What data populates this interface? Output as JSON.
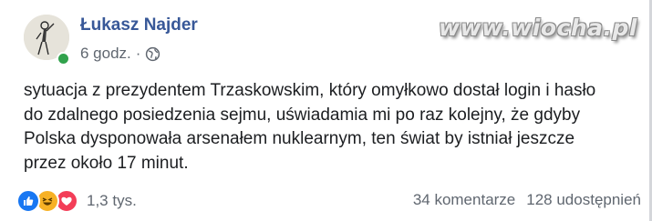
{
  "post": {
    "author": "Łukasz Najder",
    "time": "6 godz.",
    "separator": "·",
    "audience_icon": "globe-icon",
    "lines": [
      "sytuacja z prezydentem Trzaskowskim, który omyłkowo dostał login i hasło",
      "do zdalnego posiedzenia sejmu, uświadamia mi po raz kolejny, że gdyby",
      "Polska dysponowała arsenałem nuklearnym, ten świat by istniał jeszcze",
      "przez około 17 minut."
    ]
  },
  "watermark": "www.wiocha.pl",
  "footer": {
    "reaction_icons": [
      "like-icon",
      "haha-icon",
      "love-icon"
    ],
    "reaction_count": "1,3 tys.",
    "comments": "34 komentarze",
    "shares": "128 udostępnień"
  },
  "colors": {
    "name": "#385898",
    "text": "#1c1e21",
    "muted": "#606770",
    "online": "#31a24c",
    "like": "#1877f2",
    "haha": "#f7b125",
    "love": "#f33e58"
  }
}
